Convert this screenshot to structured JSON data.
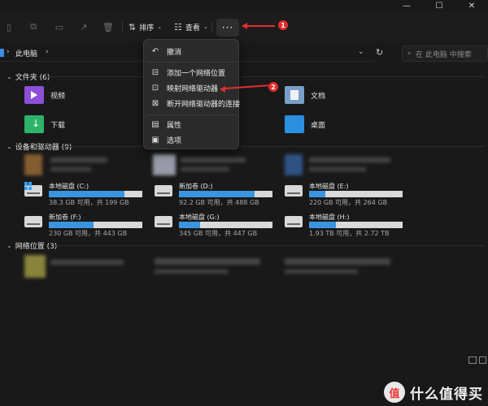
{
  "window": {
    "minimize": "—",
    "maximize": "☐",
    "close": "✕"
  },
  "toolbar": {
    "sort_label": "排序",
    "view_label": "查看",
    "more_label": "···"
  },
  "annotations": {
    "badge1": "1",
    "badge2": "2"
  },
  "address": {
    "breadcrumb": "此电脑",
    "search_placeholder": "在 此电脑 中搜索"
  },
  "sections": {
    "folders": "文件夹 (6)",
    "devices": "设备和驱动器 (9)",
    "network": "网络位置 (3)"
  },
  "folders": [
    {
      "label": "视频"
    },
    {
      "label": "下载"
    },
    {
      "label": "文档"
    },
    {
      "label": "桌面"
    }
  ],
  "drives": [
    {
      "name": "本地磁盘 (C:)",
      "free": "38.3 GB 可用，共 199 GB",
      "used_pct": 81
    },
    {
      "name": "新加卷 (D:)",
      "free": "92.2 GB 可用，共 488 GB",
      "used_pct": 81
    },
    {
      "name": "本地磁盘 (E:)",
      "free": "220 GB 可用，共 264 GB",
      "used_pct": 17
    },
    {
      "name": "新加卷 (F:)",
      "free": "230 GB 可用，共 443 GB",
      "used_pct": 48
    },
    {
      "name": "本地磁盘 (G:)",
      "free": "345 GB 可用，共 447 GB",
      "used_pct": 23
    },
    {
      "name": "本地磁盘 (H:)",
      "free": "1.93 TB 可用，共 2.72 TB",
      "used_pct": 29
    }
  ],
  "menu": {
    "items": [
      {
        "label": "撤消",
        "icon": "undo-icon"
      },
      {
        "label": "添加一个网络位置",
        "icon": "network-location-icon"
      },
      {
        "label": "映射网络驱动器",
        "icon": "map-drive-icon"
      },
      {
        "label": "断开网络驱动器的连接",
        "icon": "disconnect-drive-icon"
      },
      {
        "label": "属性",
        "icon": "properties-icon"
      },
      {
        "label": "选项",
        "icon": "options-icon"
      }
    ]
  },
  "watermark": {
    "logo": "值",
    "text": "什么值得买"
  },
  "colors": {
    "accent": "#3a95e0",
    "annotation": "#e52d2d",
    "background": "#191919",
    "menu": "#2b2b2b"
  }
}
